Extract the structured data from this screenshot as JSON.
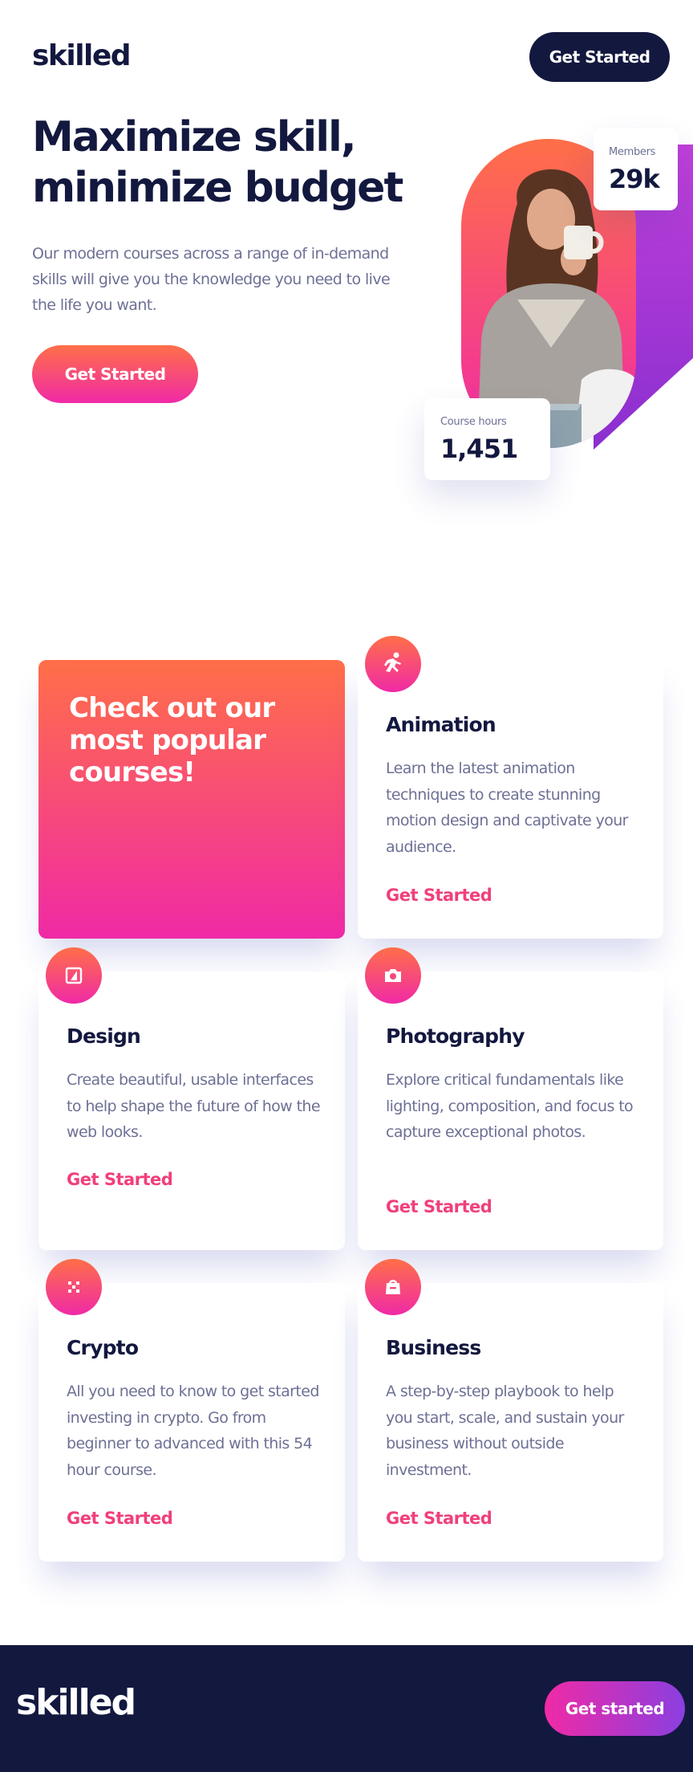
{
  "header": {
    "logo": "skilled",
    "cta": "Get Started"
  },
  "hero": {
    "title": "Maximize skill, minimize budget",
    "description": "Our modern courses across a range of in-demand skills will give you the knowledge you need to live the life you want.",
    "cta": "Get Started",
    "stats": {
      "members_label": "Members",
      "members_value": "29k",
      "hours_label": "Course hours",
      "hours_value": "1,451"
    }
  },
  "courses": {
    "promo_title": "Check out our most popular courses!",
    "items": [
      {
        "icon": "running-person-icon",
        "title": "Animation",
        "description": "Learn the latest animation techniques to create stunning motion design and captivate your audience.",
        "link": "Get Started"
      },
      {
        "icon": "design-icon",
        "title": "Design",
        "description": "Create beautiful, usable interfaces to help shape the future of how the web looks.",
        "link": "Get Started"
      },
      {
        "icon": "camera-icon",
        "title": "Photography",
        "description": "Explore critical fundamentals like lighting, composition, and focus to capture exceptional photos.",
        "link": "Get Started"
      },
      {
        "icon": "crypto-icon",
        "title": "Crypto",
        "description": "All you need to know to get started investing in crypto. Go from beginner to advanced with this 54 hour course.",
        "link": "Get Started"
      },
      {
        "icon": "shopping-bag-icon",
        "title": "Business",
        "description": "A step-by-step playbook to help you start, scale, and sustain your business without outside investment.",
        "link": "Get Started"
      }
    ]
  },
  "footer": {
    "logo": "skilled",
    "cta": "Get started"
  },
  "colors": {
    "navy": "#13183f",
    "gradient_start": "#ff6f48",
    "gradient_end": "#f02aa6",
    "link": "#f0407a",
    "purple": "#8a3fe0"
  }
}
